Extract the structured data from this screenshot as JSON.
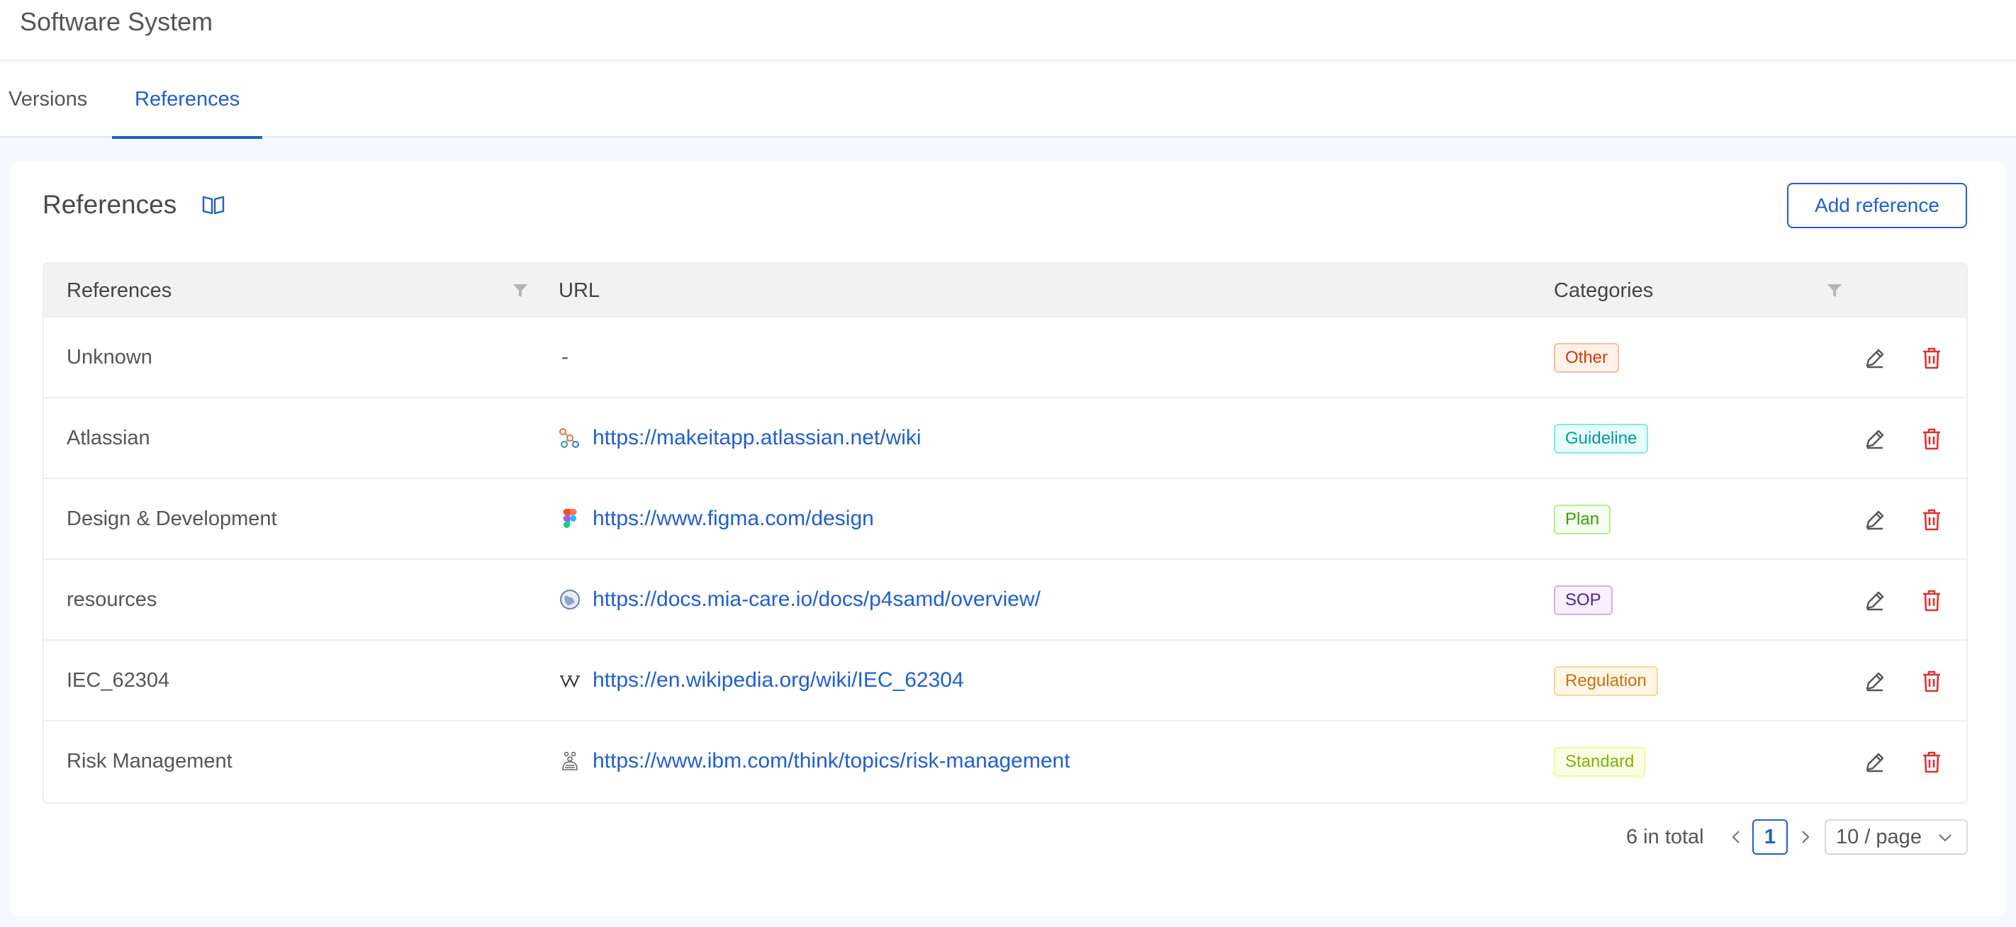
{
  "header": {
    "title": "Software System"
  },
  "tabs": [
    {
      "label": "Versions",
      "active": false
    },
    {
      "label": "References",
      "active": true
    }
  ],
  "card": {
    "title": "References",
    "add_button_label": "Add reference"
  },
  "table": {
    "columns": {
      "references": "References",
      "url": "URL",
      "categories": "Categories"
    },
    "rows": [
      {
        "name": "Unknown",
        "url": "-",
        "favicon": "none",
        "category": "Other",
        "tag_color": "#d4380d",
        "tag_bg": "#fff2e8",
        "tag_border": "#ffbb96"
      },
      {
        "name": "Atlassian",
        "url": "https://makeitapp.atlassian.net/wiki",
        "favicon": "atlassian-icon",
        "category": "Guideline",
        "tag_color": "#08979c",
        "tag_bg": "#e6fffb",
        "tag_border": "#87e8de"
      },
      {
        "name": "Design & Development",
        "url": "https://www.figma.com/design",
        "favicon": "figma-icon",
        "category": "Plan",
        "tag_color": "#389e0d",
        "tag_bg": "#f6ffed",
        "tag_border": "#b7eb8f"
      },
      {
        "name": "resources",
        "url": "https://docs.mia-care.io/docs/p4samd/overview/",
        "favicon": "globe-icon",
        "category": "SOP",
        "tag_color": "#531dab",
        "tag_bg": "#f9f0ff",
        "tag_border": "#d3adf7"
      },
      {
        "name": "IEC_62304",
        "url": "https://en.wikipedia.org/wiki/IEC_62304",
        "favicon": "wikipedia-icon",
        "category": "Regulation",
        "tag_color": "#d46b08",
        "tag_bg": "#fff7e6",
        "tag_border": "#ffd591"
      },
      {
        "name": "Risk Management",
        "url": "https://www.ibm.com/think/topics/risk-management",
        "favicon": "ibm-icon",
        "category": "Standard",
        "tag_color": "#7cb305",
        "tag_bg": "#fcffe6",
        "tag_border": "#eaff8f"
      }
    ]
  },
  "pagination": {
    "total": "6 in total",
    "current_page": "1",
    "page_size": "10 / page"
  }
}
